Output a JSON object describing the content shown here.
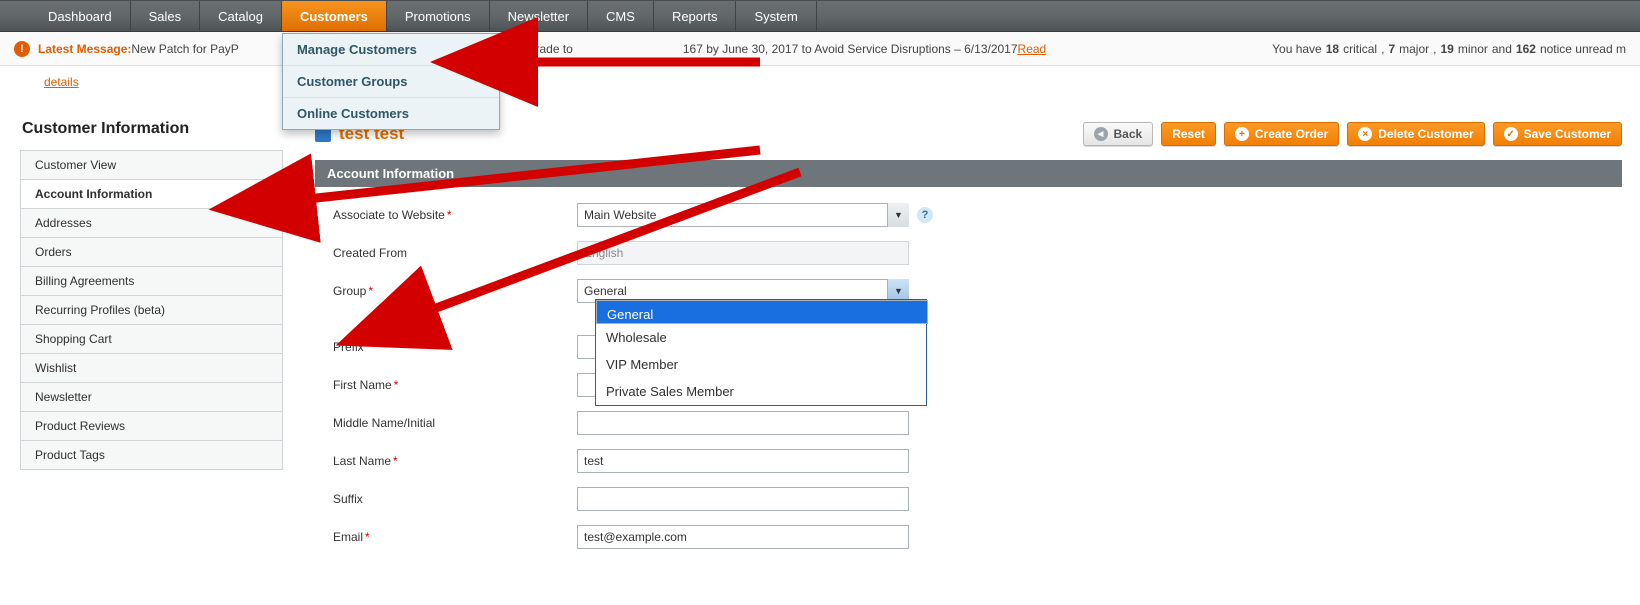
{
  "nav": {
    "items": [
      "Dashboard",
      "Sales",
      "Catalog",
      "Customers",
      "Promotions",
      "Newsletter",
      "CMS",
      "Reports",
      "System"
    ],
    "active_index": 3,
    "dropdown": [
      "Manage Customers",
      "Customer Groups",
      "Online Customers"
    ]
  },
  "notice": {
    "label": "Latest Message:",
    "text_a": " New Patch for PayP",
    "text_b": " Changes. Upgrade to ",
    "text_c": "167 by June 30, 2017 to Avoid Service Disruptions – 6/13/2017 ",
    "read": "Read",
    "details": "details",
    "right_prefix": "You have ",
    "critical_n": "18",
    "critical_l": " critical",
    "sep": ", ",
    "major_n": "7",
    "major_l": " major",
    "minor_n": "19",
    "minor_l": " minor",
    "and": " and ",
    "noticecnt_n": "162",
    "noticecnt_l": " notice unread m"
  },
  "sidebar": {
    "title": "Customer Information",
    "items": [
      "Customer View",
      "Account Information",
      "Addresses",
      "Orders",
      "Billing Agreements",
      "Recurring Profiles (beta)",
      "Shopping Cart",
      "Wishlist",
      "Newsletter",
      "Product Reviews",
      "Product Tags"
    ],
    "active_index": 1
  },
  "head": {
    "customer_name": "test test",
    "back": "Back",
    "reset": "Reset",
    "create_order": "Create Order",
    "delete_customer": "Delete Customer",
    "save_customer": "Save Customer"
  },
  "section_title": "Account Information",
  "form": {
    "associate_label": "Associate to Website",
    "associate_value": "Main Website",
    "created_label": "Created From",
    "created_value": "English",
    "group_label": "Group",
    "group_value": "General",
    "group_options": [
      "General",
      "Wholesale",
      "VIP Member",
      "Private Sales Member"
    ],
    "prefix_label": "Prefix",
    "prefix_value": "",
    "first_label": "First Name",
    "first_value": "",
    "middle_label": "Middle Name/Initial",
    "middle_value": "",
    "last_label": "Last Name",
    "last_value": "test",
    "suffix_label": "Suffix",
    "suffix_value": "",
    "email_label": "Email",
    "email_value": "test@example.com"
  }
}
